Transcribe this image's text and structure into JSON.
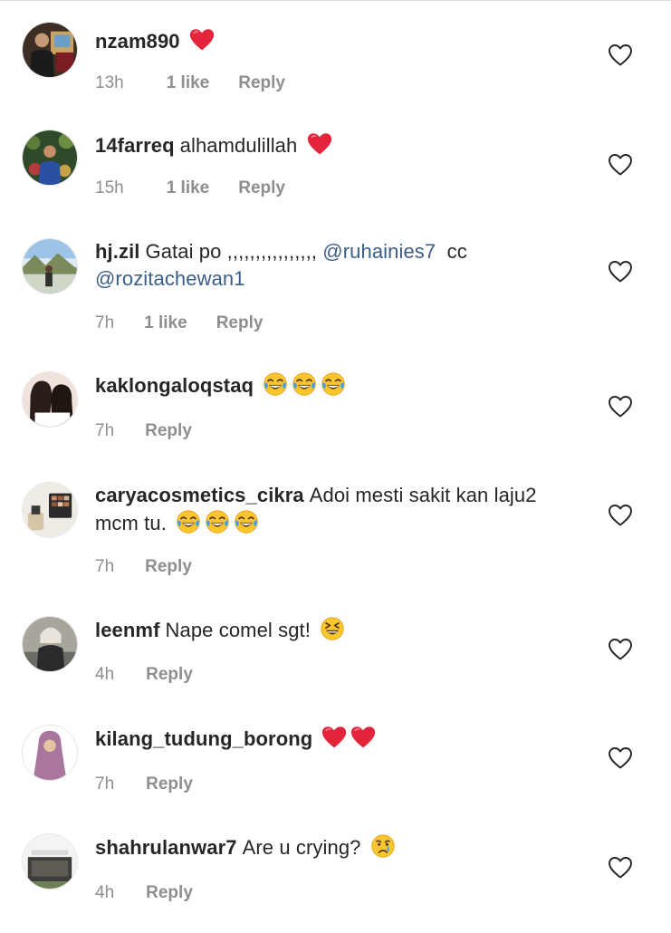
{
  "comments": [
    {
      "username": "nzam890",
      "segments": [],
      "emojis": [
        "red-heart"
      ],
      "time": "13h",
      "likes": "1 like",
      "reply": "Reply"
    },
    {
      "username": "14farreq",
      "segments": [
        {
          "text": "alhamdulillah",
          "type": "text"
        }
      ],
      "emojis": [
        "red-heart"
      ],
      "time": "15h",
      "likes": "1 like",
      "reply": "Reply"
    },
    {
      "username": "hj.zil",
      "segments": [
        {
          "text": "Gatai po ,,,,,,,,,,,,,,,, ",
          "type": "text"
        },
        {
          "text": "@ruhainies7",
          "type": "mention"
        },
        {
          "text": "  cc ",
          "type": "text"
        },
        {
          "text": "@rozitachewan1",
          "type": "mention"
        }
      ],
      "emojis": [],
      "time": "7h",
      "likes": "1 like",
      "reply": "Reply"
    },
    {
      "username": "kaklongaloqstaq",
      "segments": [],
      "emojis": [
        "tears-of-joy",
        "tears-of-joy",
        "tears-of-joy"
      ],
      "time": "7h",
      "likes": "",
      "reply": "Reply"
    },
    {
      "username": "caryacosmetics_cikra",
      "segments": [
        {
          "text": "Adoi mesti sakit kan laju2 mcm tu.",
          "type": "text"
        }
      ],
      "emojis": [
        "tears-of-joy",
        "tears-of-joy",
        "tears-of-joy"
      ],
      "time": "7h",
      "likes": "",
      "reply": "Reply"
    },
    {
      "username": "leenmf",
      "segments": [
        {
          "text": "Nape comel sgt!",
          "type": "text"
        }
      ],
      "emojis": [
        "laughing"
      ],
      "time": "4h",
      "likes": "",
      "reply": "Reply"
    },
    {
      "username": "kilang_tudung_borong",
      "segments": [],
      "emojis": [
        "red-heart",
        "red-heart"
      ],
      "time": "7h",
      "likes": "",
      "reply": "Reply"
    },
    {
      "username": "shahrulanwar7",
      "segments": [
        {
          "text": "Are u crying?",
          "type": "text"
        }
      ],
      "emojis": [
        "crying"
      ],
      "time": "4h",
      "likes": "",
      "reply": "Reply"
    }
  ],
  "colors": {
    "text": "#262626",
    "muted": "#8e8e8e",
    "mention": "#3b5d87",
    "heart_emoji": "#e0245e",
    "like_icon_stroke": "#262626"
  },
  "icons": {
    "like_button": "heart-outline-icon",
    "avatar": "avatar-photo"
  }
}
